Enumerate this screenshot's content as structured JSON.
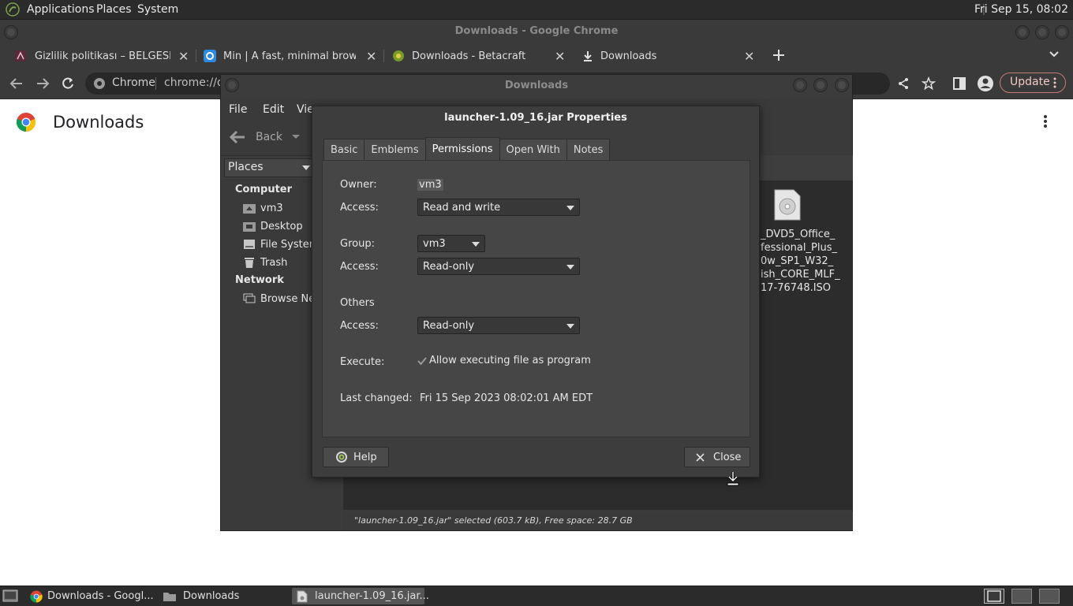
{
  "panel": {
    "menus": [
      "Applications",
      "Places",
      "System"
    ],
    "clock": "Fri Sep 15, 08:02"
  },
  "chrome": {
    "window_title": "Downloads - Google Chrome",
    "tabs": [
      {
        "title": "Gizlilik politikası – BELGESELS",
        "icon": "site-favicon-icon"
      },
      {
        "title": "Min | A fast, minimal browser t",
        "icon": "min-browser-icon"
      },
      {
        "title": "Downloads - Betacraft",
        "icon": "betacraft-icon"
      },
      {
        "title": "Downloads",
        "icon": "download-icon"
      }
    ],
    "omnibox_site": "Chrome",
    "omnibox_url": "chrome://do",
    "update_label": "Update",
    "page_title": "Downloads"
  },
  "nautilus": {
    "window_title": "Downloads",
    "menus": [
      "File",
      "Edit",
      "View"
    ],
    "back_label": "Back",
    "places_label": "Places",
    "sidebar": {
      "computer_heading": "Computer",
      "computer_items": [
        {
          "label": "vm3",
          "icon": "home-folder-icon"
        },
        {
          "label": "Desktop",
          "icon": "desktop-folder-icon"
        },
        {
          "label": "File System",
          "icon": "drive-icon"
        },
        {
          "label": "Trash",
          "icon": "trash-icon"
        }
      ],
      "network_heading": "Network",
      "network_items": [
        {
          "label": "Browse Ne",
          "icon": "network-icon"
        }
      ]
    },
    "file_label_lines": [
      "_DVD5_Office_",
      "fessional_Plus_",
      "0w_SP1_W32_",
      "ish_CORE_MLF_",
      "17-76748.ISO"
    ],
    "status_text": "\"launcher-1.09_16.jar\" selected (603.7 kB), Free space: 28.7 GB"
  },
  "dialog": {
    "title": "launcher-1.09_16.jar Properties",
    "tabs": [
      "Basic",
      "Emblems",
      "Permissions",
      "Open With",
      "Notes"
    ],
    "active_tab": "Permissions",
    "owner_label": "Owner:",
    "owner_value": "vm3",
    "owner_access_label": "Access:",
    "owner_access_value": "Read and write",
    "group_label": "Group:",
    "group_value": "vm3",
    "group_access_label": "Access:",
    "group_access_value": "Read-only",
    "others_label": "Others",
    "others_access_label": "Access:",
    "others_access_value": "Read-only",
    "execute_label": "Execute:",
    "execute_checkbox_label": "Allow executing file as program",
    "execute_checked": true,
    "last_changed_label": "Last changed:",
    "last_changed_value": "Fri 15 Sep 2023 08:02:01 AM EDT",
    "help_label": "Help",
    "close_label": "Close"
  },
  "taskbar": {
    "items": [
      {
        "label": "Downloads - Googl...",
        "icon": "chrome-icon"
      },
      {
        "label": "Downloads",
        "icon": "folder-icon"
      },
      {
        "label": "launcher-1.09_16.jar...",
        "icon": "jar-file-icon"
      }
    ]
  }
}
